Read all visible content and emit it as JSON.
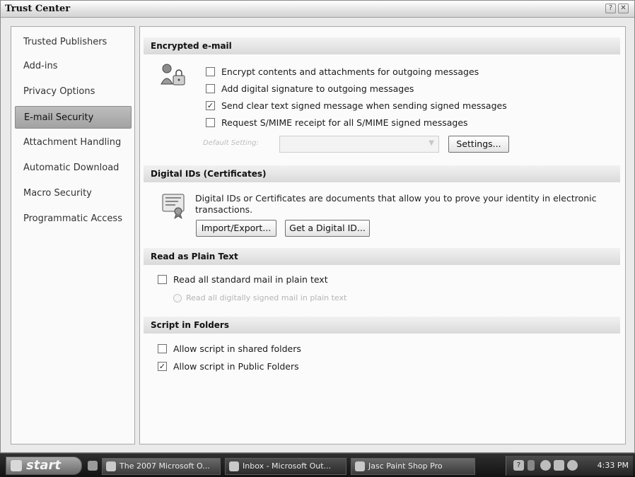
{
  "window": {
    "title": "Trust Center",
    "help_button": "?",
    "close_button": "✕"
  },
  "nav": {
    "items": [
      {
        "label": "Trusted Publishers"
      },
      {
        "label": "Add-ins"
      },
      {
        "label": "Privacy Options"
      },
      {
        "label": "E-mail Security",
        "selected": true
      },
      {
        "label": "Attachment Handling"
      },
      {
        "label": "Automatic Download"
      },
      {
        "label": "Macro Security"
      },
      {
        "label": "Programmatic Access"
      }
    ]
  },
  "encrypted": {
    "header": "Encrypted e-mail",
    "options": [
      {
        "label": "Encrypt contents and attachments for outgoing messages",
        "checked": false
      },
      {
        "label": "Add digital signature to outgoing messages",
        "checked": false
      },
      {
        "label": "Send clear text signed message when sending signed messages",
        "checked": true
      },
      {
        "label": "Request S/MIME receipt for all S/MIME signed messages",
        "checked": false
      }
    ],
    "default_setting_label": "Default Setting:",
    "default_setting_value": "",
    "settings_button": "Settings..."
  },
  "digital_ids": {
    "header": "Digital IDs (Certificates)",
    "description": "Digital IDs or Certificates are documents that allow you to prove your identity in electronic transactions.",
    "import_export_button": "Import/Export...",
    "get_id_button": "Get a Digital ID..."
  },
  "plain_text": {
    "header": "Read as Plain Text",
    "read_all_label": "Read all standard mail in plain text",
    "read_all_checked": false,
    "read_signed_label": "Read all digitally signed mail in plain text"
  },
  "script_folders": {
    "header": "Script in Folders",
    "options": [
      {
        "label": "Allow script in shared folders",
        "checked": false
      },
      {
        "label": "Allow script in Public Folders",
        "checked": true
      }
    ]
  },
  "taskbar": {
    "start_label": "start",
    "tasks": [
      {
        "label": "The 2007 Microsoft O..."
      },
      {
        "label": "Inbox - Microsoft Out..."
      },
      {
        "label": "Jasc Paint Shop Pro"
      }
    ],
    "clock": "4:33 PM"
  },
  "colors": {
    "panel_bg": "#fbfbfb",
    "header_bg": "#dadada",
    "selected_nav": "#a2a2a2",
    "taskbar": "#1b1b1b"
  }
}
